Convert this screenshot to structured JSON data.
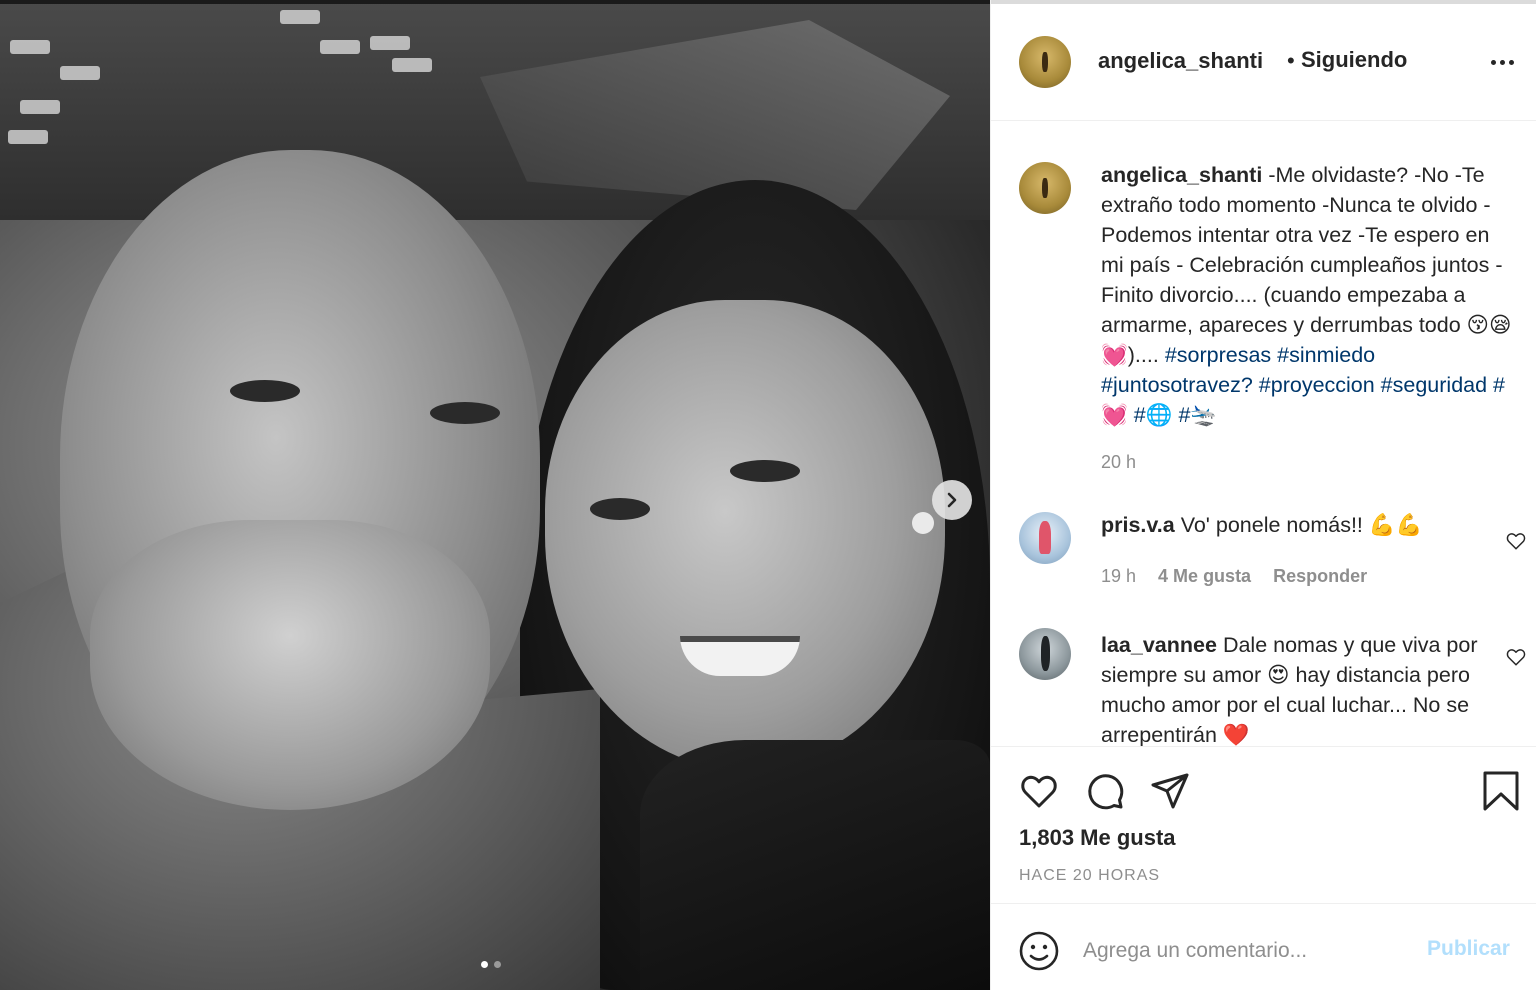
{
  "post": {
    "author": "angelica_shanti",
    "follow_sep": "•",
    "follow_status": "Siguiendo",
    "carousel": {
      "count": 2,
      "active_index": 0
    },
    "caption": {
      "username": "angelica_shanti",
      "text": "-Me olvidaste? -No -Te extraño todo momento -Nunca te olvido -Podemos intentar otra vez -Te espero en mi país - Celebración cumpleaños juntos -Finito divorcio.... (cuando empezaba a armarme, apareces y derrumbas todo 😚😪💓)....",
      "hashtags_line1": "#sorpresas #sinmiedo #juntosotravez?",
      "hashtags_line2": "#proyeccion #seguridad #💓 #🌐 #🛬",
      "time": "20 h"
    },
    "comments": [
      {
        "username": "pris.v.a",
        "text": "Vo' ponele nomás!! 💪💪",
        "time": "19 h",
        "likes": "4 Me gusta",
        "reply": "Responder"
      },
      {
        "username": "laa_vannee",
        "text": "Dale nomas y que viva por siempre su amor 😍 hay distancia pero mucho amor por el cual luchar... No se arrepentirán ❤️"
      }
    ],
    "like_count": "1,803 Me gusta",
    "timestamp": "HACE 20 HORAS",
    "comment_box": {
      "placeholder": "Agrega un comentario...",
      "publish_label": "Publicar"
    }
  },
  "icons": {
    "like": "heart-icon",
    "comment": "comment-icon",
    "share": "paper-plane-icon",
    "save": "bookmark-icon",
    "emoji": "smiley-icon",
    "more": "more-icon",
    "next": "chevron-right-icon"
  },
  "colors": {
    "text": "#262626",
    "muted": "#8e8e8e",
    "hashtag": "#00376b",
    "publish_disabled": "#b2dffc",
    "border": "#efefef"
  }
}
